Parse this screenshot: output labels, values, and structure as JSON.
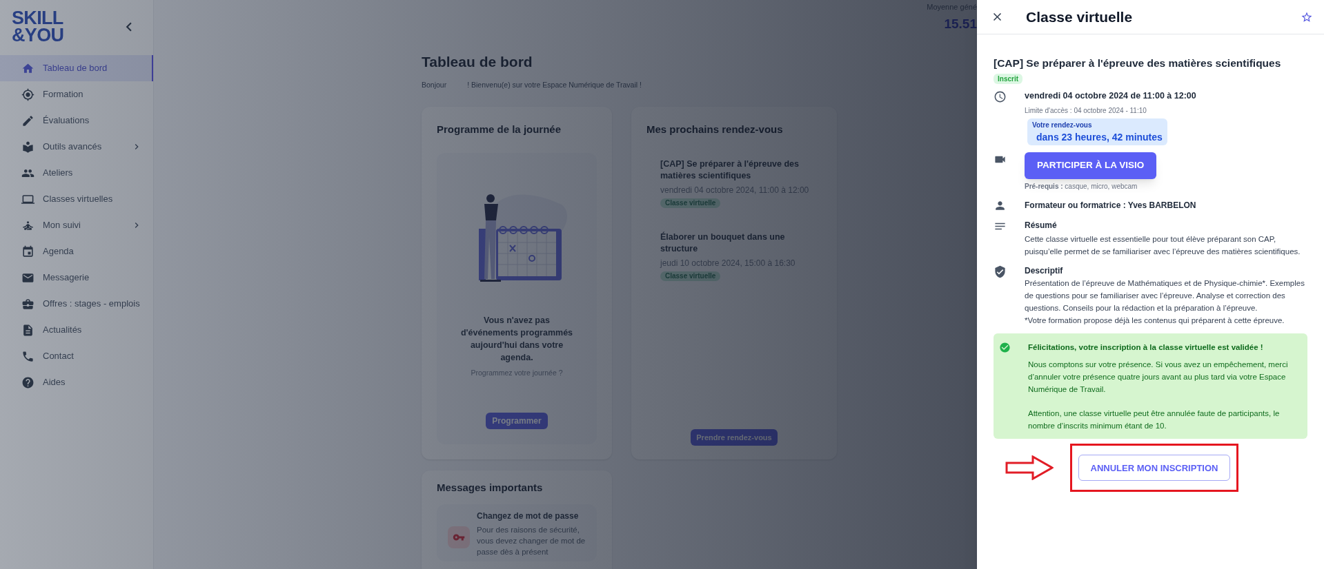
{
  "sidebar": {
    "logo": [
      "SKILL",
      "&YOU"
    ],
    "items": [
      {
        "label": "Tableau de bord",
        "selected": true,
        "has_submenu": false
      },
      {
        "label": "Formation",
        "selected": false,
        "has_submenu": false
      },
      {
        "label": "Évaluations",
        "selected": false,
        "has_submenu": false
      },
      {
        "label": "Outils avancés",
        "selected": false,
        "has_submenu": true
      },
      {
        "label": "Ateliers",
        "selected": false,
        "has_submenu": false
      },
      {
        "label": "Classes virtuelles",
        "selected": false,
        "has_submenu": false
      },
      {
        "label": "Mon suivi",
        "selected": false,
        "has_submenu": true
      },
      {
        "label": "Agenda",
        "selected": false,
        "has_submenu": false
      },
      {
        "label": "Messagerie",
        "selected": false,
        "has_submenu": false
      },
      {
        "label": "Offres : stages - emplois",
        "selected": false,
        "has_submenu": false
      },
      {
        "label": "Actualités",
        "selected": false,
        "has_submenu": false
      },
      {
        "label": "Contact",
        "selected": false,
        "has_submenu": false
      },
      {
        "label": "Aides",
        "selected": false,
        "has_submenu": false
      }
    ]
  },
  "main": {
    "average": {
      "label": "Moyenne géné",
      "value": "15.51"
    },
    "title": "Tableau de bord",
    "greeting": {
      "hello": "Bonjour",
      "welcome": "! Bienvenu(e) sur votre Espace Numérique de Travail !"
    },
    "day_program": {
      "title": "Programme de la journée",
      "empty_title": "Vous n'avez pas d'événements programmés aujourd'hui dans votre agenda.",
      "empty_hint": "Programmez votre journée ?",
      "button": "Programmer"
    },
    "appointments": {
      "title": "Mes prochains rendez-vous",
      "items": [
        {
          "title": "[CAP] Se préparer à l'épreuve des matières scientifiques",
          "date": "vendredi 04 octobre 2024, 11:00 à 12:00",
          "tag": "Classe virtuelle"
        },
        {
          "title": "Élaborer un bouquet dans une structure",
          "date": "jeudi 10 octobre 2024, 15:00 à 16:30",
          "tag": "Classe virtuelle"
        }
      ],
      "button": "Prendre rendez-vous"
    },
    "messages": {
      "title": "Messages importants",
      "items": [
        {
          "title": "Changez de mot de passe",
          "text": "Pour des raisons de sécurité, vous devez changer de mot de passe dès à présent"
        }
      ]
    }
  },
  "panel": {
    "title": "Classe virtuelle",
    "favorite": false,
    "course_title": "[CAP] Se préparer à l'épreuve des matières scientifiques",
    "status": "Inscrit",
    "schedule": {
      "date": "vendredi 04 octobre 2024 de 11:00 à 12:00",
      "access_limit": "Limite d'accès : 04 octobre 2024 - 11:10",
      "countdown_label": "Votre rendez-vous",
      "countdown": "dans 23 heures, 42 minutes"
    },
    "join_button": "PARTICIPER À LA VISIO",
    "prerequisites": "**Pré-requis :** casque, micro, webcam",
    "trainer": "Formateur ou formatrice : Yves BARBELON",
    "summary": {
      "title": "Résumé",
      "text": "Cette classe virtuelle est essentielle pour tout élève préparant son CAP, puisqu’elle permet de se familiariser avec l’épreuve des matières scientifiques."
    },
    "description": {
      "title": "Descriptif",
      "paragraphs": [
        "Présentation de l’épreuve de Mathématiques et de Physique-chimie*. Exemples de questions pour se familiariser avec l’épreuve. Analyse et correction des questions. Conseils pour la rédaction et la préparation à l’épreuve.",
        "*Votre formation propose déjà les contenus qui préparent à cette épreuve."
      ]
    },
    "alert": {
      "title": "Félicitations, votre inscription à la classe virtuelle est validée !",
      "paragraphs": [
        "Nous comptons sur votre présence. Si vous avez un empêchement, merci d’annuler votre présence quatre jours avant au plus tard via votre Espace Numérique de Travail.",
        "Attention, une classe virtuelle peut être annulée faute de participants, le nombre d’inscrits minimum étant de 10."
      ]
    },
    "cancel_button": "ANNULER MON INSCRIPTION"
  }
}
